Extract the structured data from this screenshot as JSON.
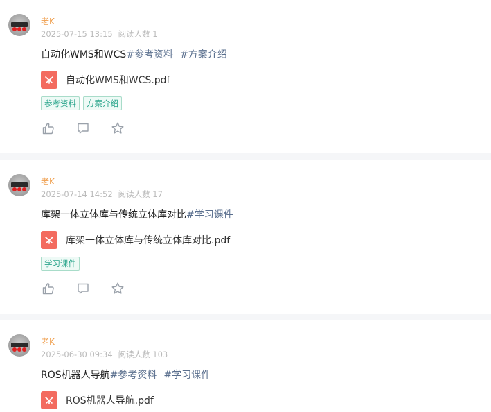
{
  "posts": [
    {
      "author": "老K",
      "date": "2025-07-15 13:15",
      "readers": "阅读人数 1",
      "title_main": "自动化WMS和WCS",
      "hashtags": [
        "#参考资料",
        "#方案介绍"
      ],
      "file_name": "自动化WMS和WCS.pdf",
      "tags": [
        "参考资料",
        "方案介绍"
      ]
    },
    {
      "author": "老K",
      "date": "2025-07-14 14:52",
      "readers": "阅读人数 17",
      "title_main": "库架一体立体库与传统立体库对比",
      "hashtags": [
        "#学习课件"
      ],
      "file_name": "库架一体立体库与传统立体库对比.pdf",
      "tags": [
        "学习课件"
      ]
    },
    {
      "author": "老K",
      "date": "2025-06-30 09:34",
      "readers": "阅读人数 103",
      "title_main": "ROS机器人导航",
      "hashtags": [
        "#参考资料",
        "#学习课件"
      ],
      "file_name": "ROS机器人导航.pdf",
      "tags": []
    }
  ],
  "icons": {
    "like": "thumbs-up-icon",
    "comment": "comment-icon",
    "favorite": "star-icon",
    "file": "pdf-icon"
  },
  "colors": {
    "author": "#f0a050",
    "hashtag": "#5a6f8e",
    "tag_text": "#2ba58c",
    "tag_border": "#a8dcc9",
    "pdf": "#f36b5f",
    "separator": "#f5f6f8"
  }
}
